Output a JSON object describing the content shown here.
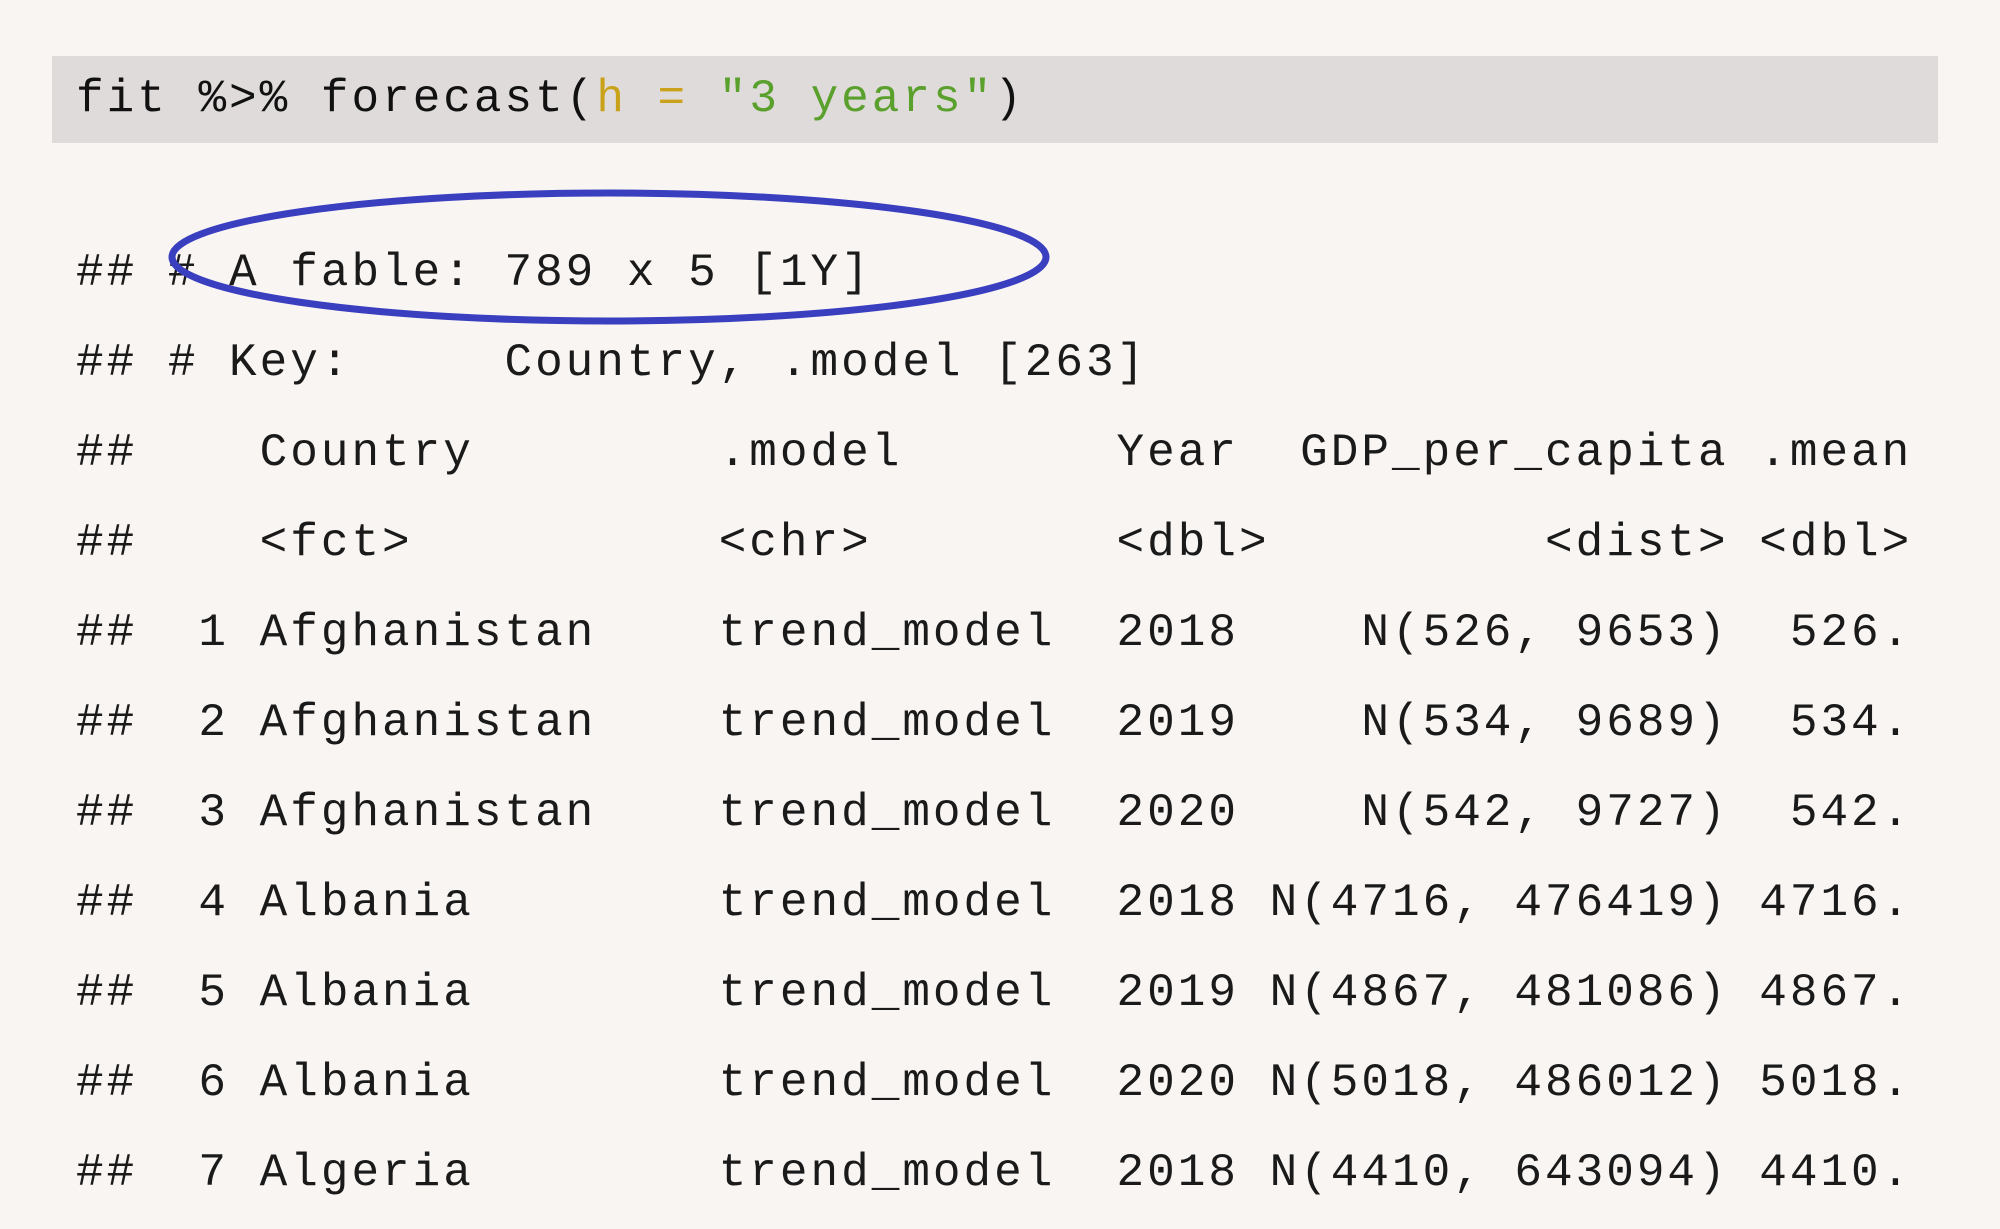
{
  "code": {
    "object": "fit",
    "pipe": "%>%",
    "function": "forecast",
    "open_paren": "(",
    "arg_name": "h",
    "equals": "=",
    "arg_value": "\"3 years\"",
    "close_paren": ")"
  },
  "output": {
    "prefix": "##",
    "summary_line": "# A fable: 789 x 5 [1Y]",
    "key_line": "# Key:     Country, .model [263]",
    "columns": [
      "Country",
      ".model",
      "Year",
      "GDP_per_capita",
      ".mean"
    ],
    "column_types": [
      "<fct>",
      "<chr>",
      "<dbl>",
      "<dist>",
      "<dbl>"
    ],
    "rows": [
      {
        "index": "1",
        "country": "Afghanistan",
        "model": "trend_model",
        "year": "2018",
        "gdp": "N(526, 9653)",
        "mean": "526."
      },
      {
        "index": "2",
        "country": "Afghanistan",
        "model": "trend_model",
        "year": "2019",
        "gdp": "N(534, 9689)",
        "mean": "534."
      },
      {
        "index": "3",
        "country": "Afghanistan",
        "model": "trend_model",
        "year": "2020",
        "gdp": "N(542, 9727)",
        "mean": "542."
      },
      {
        "index": "4",
        "country": "Albania",
        "model": "trend_model",
        "year": "2018",
        "gdp": "N(4716, 476419)",
        "mean": "4716."
      },
      {
        "index": "5",
        "country": "Albania",
        "model": "trend_model",
        "year": "2019",
        "gdp": "N(4867, 481086)",
        "mean": "4867."
      },
      {
        "index": "6",
        "country": "Albania",
        "model": "trend_model",
        "year": "2020",
        "gdp": "N(5018, 486012)",
        "mean": "5018."
      },
      {
        "index": "7",
        "country": "Algeria",
        "model": "trend_model",
        "year": "2018",
        "gdp": "N(4410, 643094)",
        "mean": "4410."
      }
    ]
  },
  "annotation": {
    "shape": "ellipse",
    "target": "summary_line",
    "color": "#3a3fc0"
  }
}
